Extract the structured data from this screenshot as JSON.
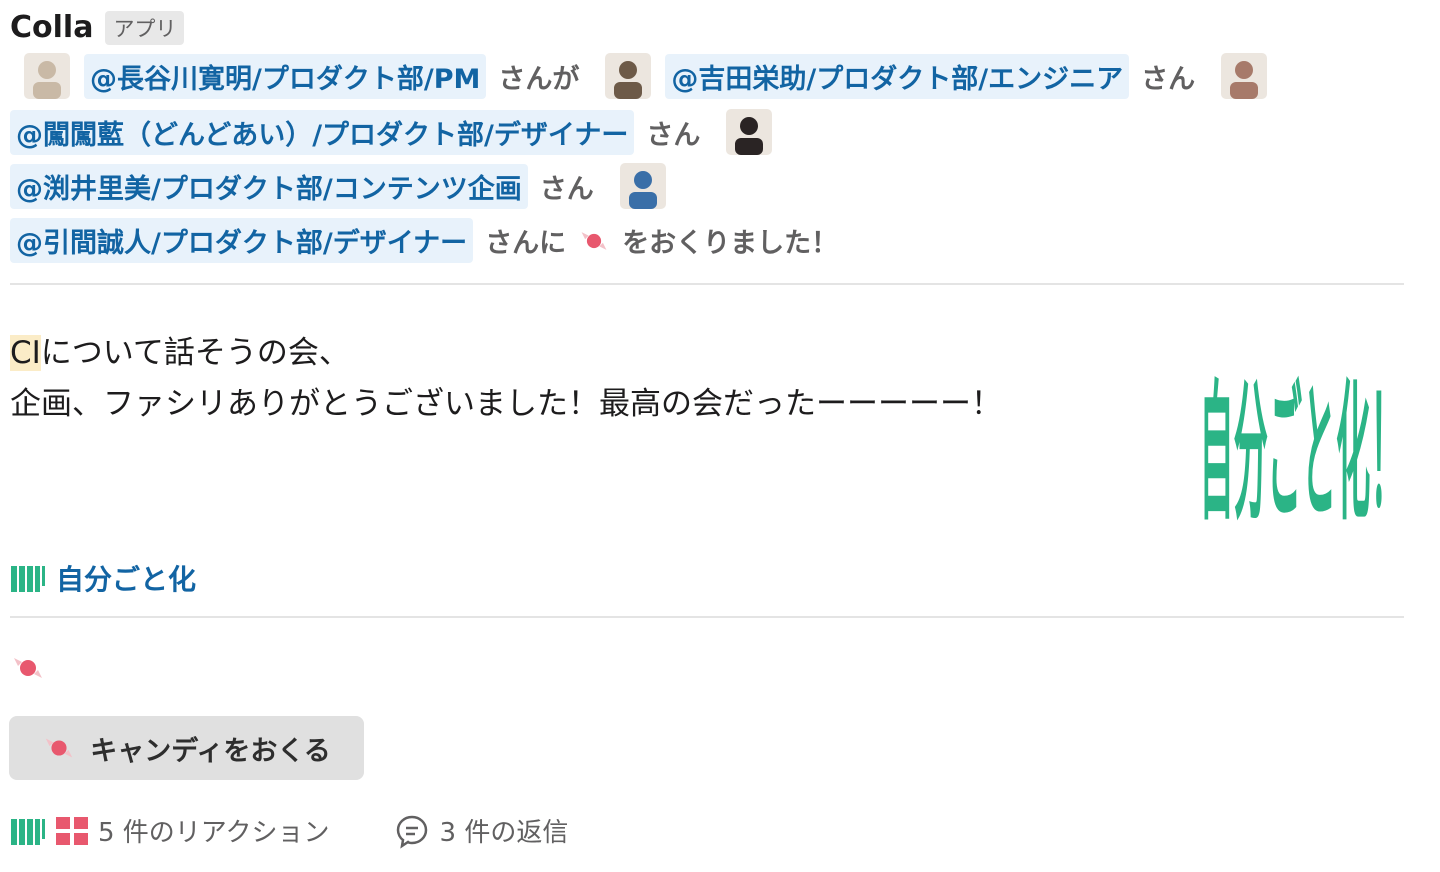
{
  "app": {
    "name": "Colla",
    "badge": "アプリ"
  },
  "intro_lines": [
    {
      "segments": [
        {
          "type": "avatar",
          "name": "avatar-hasegawa"
        },
        {
          "type": "mention",
          "text": "@長谷川寛明/プロダクト部/PM"
        },
        {
          "type": "text",
          "text": "さんが"
        },
        {
          "type": "avatar",
          "name": "avatar-yoshida"
        },
        {
          "type": "mention",
          "text": "@吉田栄助/プロダクト部/エンジニア"
        },
        {
          "type": "text",
          "text": "さん"
        },
        {
          "type": "avatar",
          "name": "avatar-ran"
        }
      ]
    },
    {
      "segments": [
        {
          "type": "mention",
          "text": "@闖闖藍（どんどあい）/プロダクト部/デザイナー"
        },
        {
          "type": "text",
          "text": "さん"
        },
        {
          "type": "avatar",
          "name": "avatar-fuchii"
        }
      ]
    },
    {
      "segments": [
        {
          "type": "mention",
          "text": "@渕井里美/プロダクト部/コンテンツ企画"
        },
        {
          "type": "text",
          "text": "さん"
        },
        {
          "type": "avatar",
          "name": "avatar-hikima"
        }
      ]
    },
    {
      "segments": [
        {
          "type": "mention",
          "text": "@引間誠人/プロダクト部/デザイナー"
        },
        {
          "type": "text",
          "text": "さんに"
        },
        {
          "type": "candy"
        },
        {
          "type": "text",
          "text": "をおくりました！"
        }
      ]
    }
  ],
  "message": {
    "highlight": "CI",
    "line1_rest": "について話そうの会、",
    "line2": "企画、ファシリありがとうございました！最高の会だったーーーーー！"
  },
  "sticker": {
    "text": "自分ごと化！",
    "color": "#2bb486"
  },
  "tag": {
    "label": "自分ごと化"
  },
  "send_button": {
    "label": "キャンディをおくる"
  },
  "footer": {
    "reactions": "5 件のリアクション",
    "replies": "3 件の返信"
  },
  "colors": {
    "mention": "#1264a3",
    "mention_bg": "#e8f2fb",
    "sticker_green": "#2bb486",
    "candy_pink": "#e8586e"
  }
}
